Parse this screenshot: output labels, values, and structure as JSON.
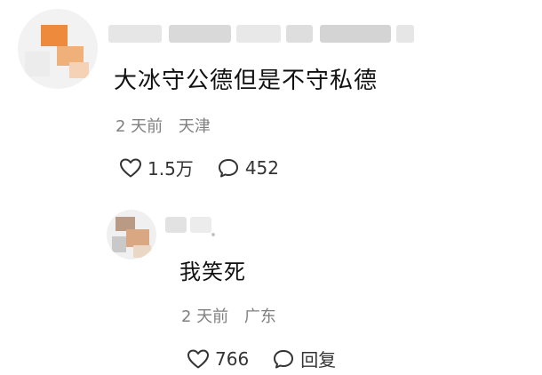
{
  "comment": {
    "text": "大冰守公德但是不守私德",
    "time": "2 天前",
    "location": "天津",
    "like_count": "1.5万",
    "reply_count": "452",
    "colors": {
      "text": "#111111",
      "meta": "#808080",
      "icon": "#333333"
    },
    "icons": {
      "like": "heart-icon",
      "comment": "comment-bubble-icon"
    }
  },
  "reply": {
    "text": "我笑死",
    "time": "2 天前",
    "location": "广东",
    "like_count": "766",
    "reply_label": "回复",
    "icons": {
      "like": "heart-icon",
      "reply": "comment-bubble-icon"
    }
  }
}
